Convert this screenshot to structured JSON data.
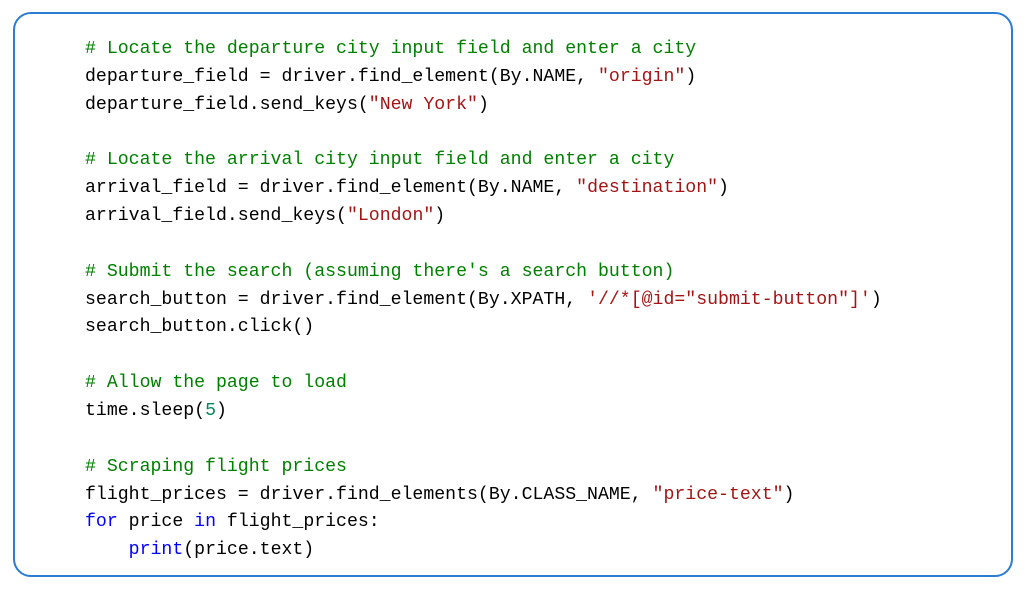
{
  "code": {
    "tokens": [
      {
        "text": "# Locate the departure city input field and enter a city",
        "cls": "comment"
      },
      {
        "text": "\n",
        "cls": ""
      },
      {
        "text": "departure_field = driver.find_element(By.NAME, ",
        "cls": ""
      },
      {
        "text": "\"origin\"",
        "cls": "string"
      },
      {
        "text": ")",
        "cls": ""
      },
      {
        "text": "\n",
        "cls": ""
      },
      {
        "text": "departure_field.send_keys(",
        "cls": ""
      },
      {
        "text": "\"New York\"",
        "cls": "string"
      },
      {
        "text": ")",
        "cls": ""
      },
      {
        "text": "\n\n",
        "cls": ""
      },
      {
        "text": "# Locate the arrival city input field and enter a city",
        "cls": "comment"
      },
      {
        "text": "\n",
        "cls": ""
      },
      {
        "text": "arrival_field = driver.find_element(By.NAME, ",
        "cls": ""
      },
      {
        "text": "\"destination\"",
        "cls": "string"
      },
      {
        "text": ")",
        "cls": ""
      },
      {
        "text": "\n",
        "cls": ""
      },
      {
        "text": "arrival_field.send_keys(",
        "cls": ""
      },
      {
        "text": "\"London\"",
        "cls": "string"
      },
      {
        "text": ")",
        "cls": ""
      },
      {
        "text": "\n\n",
        "cls": ""
      },
      {
        "text": "# Submit the search (assuming there's a search button)",
        "cls": "comment"
      },
      {
        "text": "\n",
        "cls": ""
      },
      {
        "text": "search_button = driver.find_element(By.XPATH, ",
        "cls": ""
      },
      {
        "text": "'//*[@id=\"submit-button\"]'",
        "cls": "string"
      },
      {
        "text": ")",
        "cls": ""
      },
      {
        "text": "\n",
        "cls": ""
      },
      {
        "text": "search_button.click()",
        "cls": ""
      },
      {
        "text": "\n\n",
        "cls": ""
      },
      {
        "text": "# Allow the page to load",
        "cls": "comment"
      },
      {
        "text": "\n",
        "cls": ""
      },
      {
        "text": "time.sleep(",
        "cls": ""
      },
      {
        "text": "5",
        "cls": "number"
      },
      {
        "text": ")",
        "cls": ""
      },
      {
        "text": "\n\n",
        "cls": ""
      },
      {
        "text": "# Scraping flight prices",
        "cls": "comment"
      },
      {
        "text": "\n",
        "cls": ""
      },
      {
        "text": "flight_prices = driver.find_elements(By.CLASS_NAME, ",
        "cls": ""
      },
      {
        "text": "\"price-text\"",
        "cls": "string"
      },
      {
        "text": ")",
        "cls": ""
      },
      {
        "text": "\n",
        "cls": ""
      },
      {
        "text": "for",
        "cls": "keyword"
      },
      {
        "text": " price ",
        "cls": ""
      },
      {
        "text": "in",
        "cls": "keyword"
      },
      {
        "text": " flight_prices:",
        "cls": ""
      },
      {
        "text": "\n    ",
        "cls": ""
      },
      {
        "text": "print",
        "cls": "builtin"
      },
      {
        "text": "(price.text)",
        "cls": ""
      }
    ]
  }
}
